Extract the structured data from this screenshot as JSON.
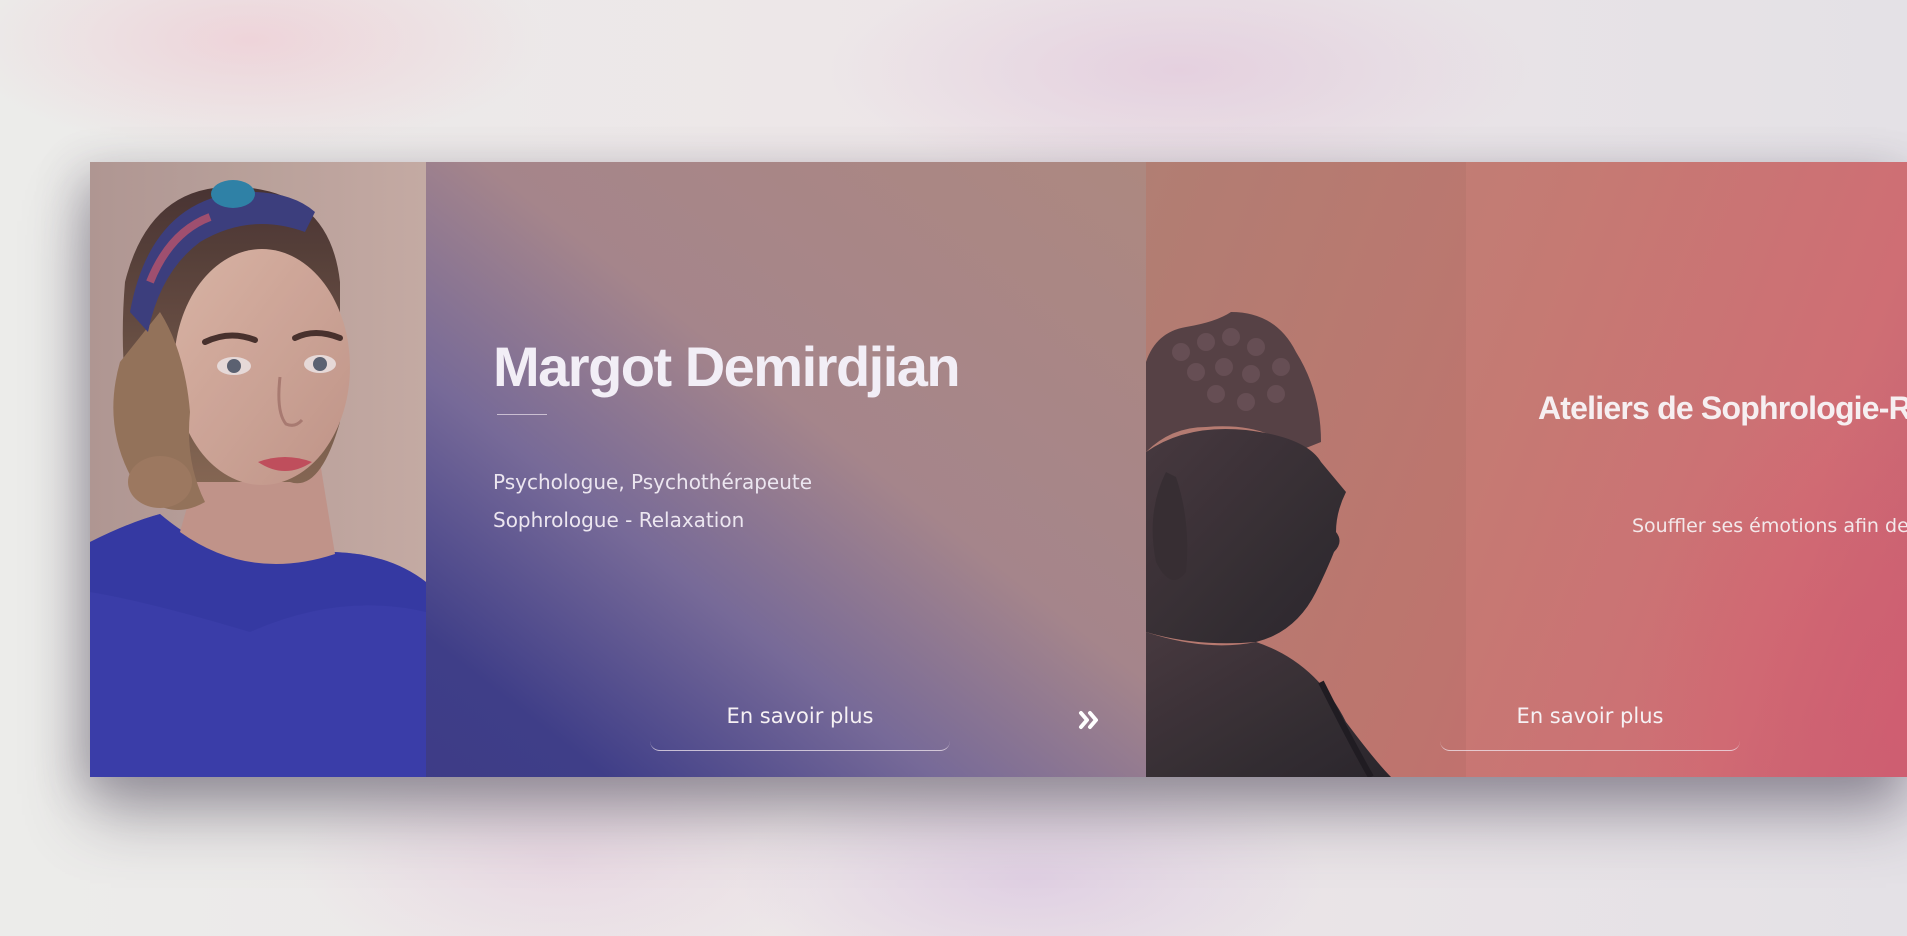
{
  "slides": [
    {
      "title": "Margot Demirdjian",
      "subtitle_lines": [
        "Psychologue, Psychothérapeute",
        "Sophrologue - Relaxation"
      ],
      "cta_label": "En savoir plus",
      "image": "portrait-photo"
    },
    {
      "title": "Ateliers de Sophrologie-R",
      "text": "Souffler ses émotions afin de l",
      "cta_label": "En savoir plus",
      "image": "buddha-statue-photo"
    }
  ],
  "controls": {
    "next_icon": "double-chevron-right-icon"
  },
  "colors": {
    "slide_1_gradient": [
      "#3a3884",
      "#ad8880"
    ],
    "slide_2_gradient": [
      "#b98478",
      "#c36173"
    ],
    "text": "#f2eef6"
  }
}
